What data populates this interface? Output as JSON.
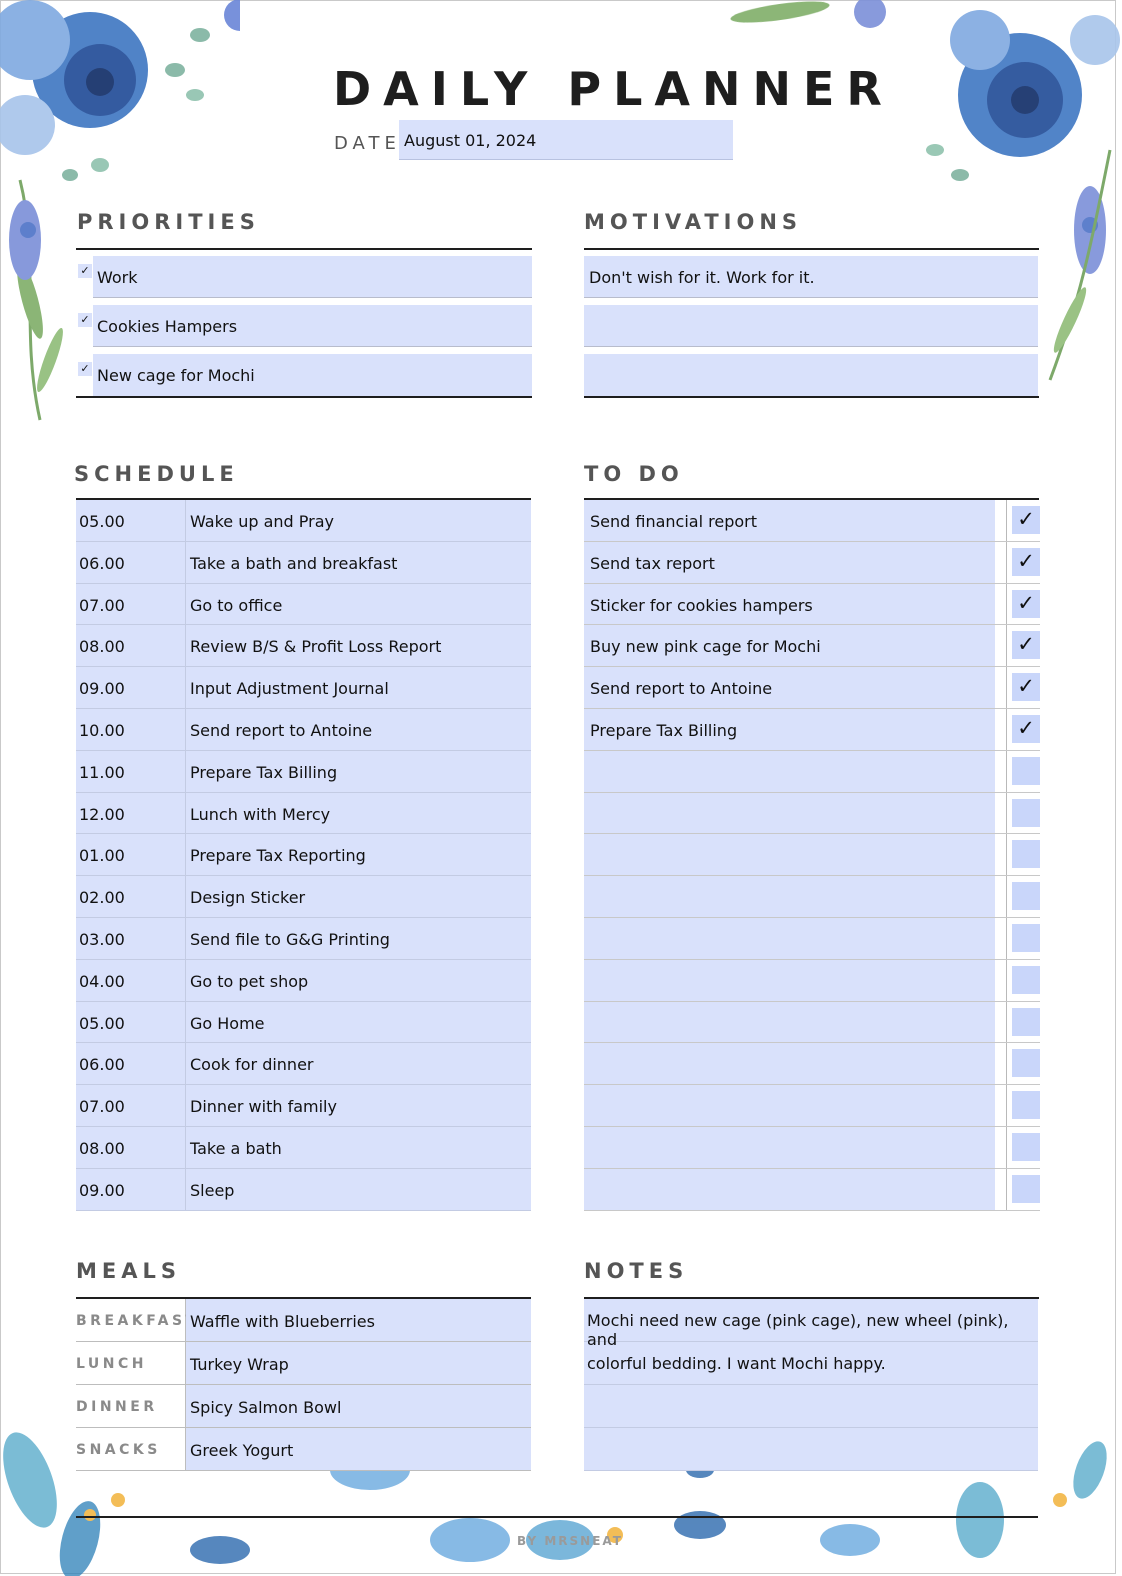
{
  "header": {
    "title": "DAILY PLANNER",
    "date_label": "DATE :",
    "date_value": "August 01, 2024"
  },
  "priorities": {
    "title": "PRIORITIES",
    "items": [
      {
        "text": "Work",
        "checked": true,
        "mark": "✓"
      },
      {
        "text": "Cookies Hampers",
        "checked": true,
        "mark": "✓"
      },
      {
        "text": "New cage for Mochi",
        "checked": true,
        "mark": "✓"
      }
    ]
  },
  "motivations": {
    "title": "MOTIVATIONS",
    "items": [
      "Don't wish for it. Work for it.",
      "",
      ""
    ]
  },
  "schedule": {
    "title": "SCHEDULE",
    "rows": [
      {
        "time": "05.00",
        "task": "Wake up and Pray"
      },
      {
        "time": "06.00",
        "task": "Take a bath and breakfast"
      },
      {
        "time": "07.00",
        "task": "Go to office"
      },
      {
        "time": "08.00",
        "task": "Review B/S & Profit Loss Report"
      },
      {
        "time": "09.00",
        "task": "Input Adjustment Journal"
      },
      {
        "time": "10.00",
        "task": "Send report to Antoine"
      },
      {
        "time": "11.00",
        "task": "Prepare Tax Billing"
      },
      {
        "time": "12.00",
        "task": "Lunch with Mercy"
      },
      {
        "time": "01.00",
        "task": "Prepare Tax Reporting"
      },
      {
        "time": "02.00",
        "task": "Design Sticker"
      },
      {
        "time": "03.00",
        "task": "Send file to G&G Printing"
      },
      {
        "time": "04.00",
        "task": "Go to pet shop"
      },
      {
        "time": "05.00",
        "task": "Go Home"
      },
      {
        "time": "06.00",
        "task": "Cook for dinner"
      },
      {
        "time": "07.00",
        "task": "Dinner with family"
      },
      {
        "time": "08.00",
        "task": "Take a bath"
      },
      {
        "time": "09.00",
        "task": "Sleep"
      }
    ]
  },
  "todo": {
    "title": "TO DO",
    "items": [
      {
        "text": "Send financial report",
        "checked": true,
        "mark": "✓"
      },
      {
        "text": "Send tax report",
        "checked": true,
        "mark": "✓"
      },
      {
        "text": "Sticker for cookies hampers",
        "checked": true,
        "mark": "✓"
      },
      {
        "text": "Buy new pink cage for Mochi",
        "checked": true,
        "mark": "✓"
      },
      {
        "text": "Send report to Antoine",
        "checked": true,
        "mark": "✓"
      },
      {
        "text": "Prepare Tax Billing",
        "checked": true,
        "mark": "✓"
      },
      {
        "text": "",
        "checked": false,
        "mark": ""
      },
      {
        "text": "",
        "checked": false,
        "mark": ""
      },
      {
        "text": "",
        "checked": false,
        "mark": ""
      },
      {
        "text": "",
        "checked": false,
        "mark": ""
      },
      {
        "text": "",
        "checked": false,
        "mark": ""
      },
      {
        "text": "",
        "checked": false,
        "mark": ""
      },
      {
        "text": "",
        "checked": false,
        "mark": ""
      },
      {
        "text": "",
        "checked": false,
        "mark": ""
      },
      {
        "text": "",
        "checked": false,
        "mark": ""
      },
      {
        "text": "",
        "checked": false,
        "mark": ""
      },
      {
        "text": "",
        "checked": false,
        "mark": ""
      }
    ]
  },
  "meals": {
    "title": "MEALS",
    "rows": [
      {
        "label": "BREAKFAST",
        "value": "Waffle with Blueberries"
      },
      {
        "label": "LUNCH",
        "value": "Turkey Wrap"
      },
      {
        "label": "DINNER",
        "value": "Spicy Salmon Bowl"
      },
      {
        "label": "SNACKS",
        "value": "Greek Yogurt"
      }
    ]
  },
  "notes": {
    "title": "NOTES",
    "lines": [
      "Mochi need new cage (pink cage), new wheel (pink), and",
      "colorful bedding. I want Mochi happy.",
      "",
      ""
    ]
  },
  "footer": {
    "credit": "BY MRSNEAT"
  },
  "colors": {
    "field_fill": "#d9e1fb",
    "checkbox_fill": "#c9d6fa",
    "heading_gray": "#555555",
    "rule_black": "#1e1e1e"
  },
  "decorations": {
    "top_left": "watercolor-blue-floral",
    "top_right": "watercolor-blue-floral",
    "bottom": "watercolor-blue-leaves-and-flowers"
  }
}
